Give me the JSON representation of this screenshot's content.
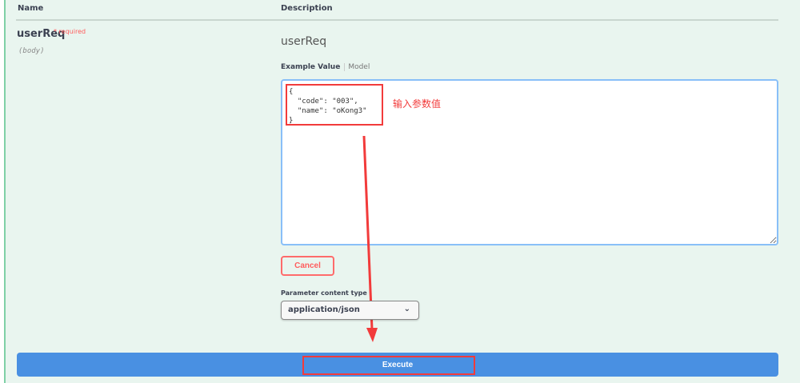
{
  "table": {
    "header_name": "Name",
    "header_description": "Description"
  },
  "parameter": {
    "name": "userReq",
    "required_marker": "*",
    "required_label": "required",
    "location": "(body)",
    "description": "userReq"
  },
  "tabs": {
    "example_value": "Example Value",
    "model": "Model"
  },
  "body_value": "{\n  \"code\": \"003\",\n  \"name\": \"oKong3\"\n}",
  "annotation": "输入参数值",
  "cancel_label": "Cancel",
  "content_type": {
    "label": "Parameter content type",
    "selected": "application/json"
  },
  "execute_label": "Execute",
  "colors": {
    "highlight": "#f23b3b",
    "execute": "#4990e2"
  }
}
